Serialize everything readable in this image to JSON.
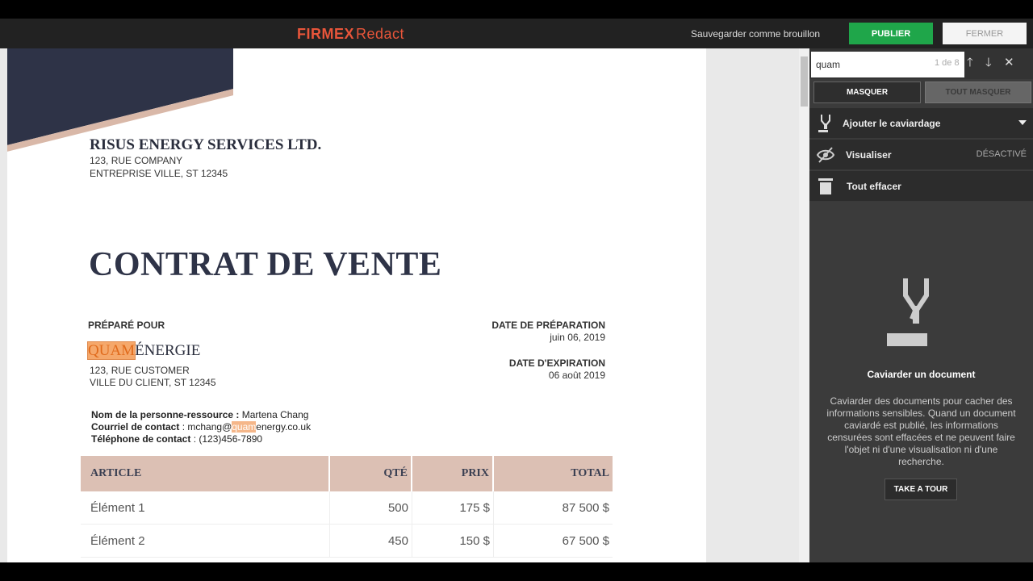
{
  "header": {
    "logo_firmex": "FIRMEX",
    "logo_redact": "Redact",
    "save_draft": "Sauvegarder comme brouillon",
    "publish": "PUBLIER",
    "close": "FERMER"
  },
  "document": {
    "company": {
      "name": "RISUS ENERGY SERVICES LTD.",
      "address_line1": "123, RUE COMPANY",
      "address_line2": "ENTREPRISE VILLE, ST 12345"
    },
    "title": "CONTRAT DE VENTE",
    "prepared_for_label": "PRÉPARÉ POUR",
    "prep_date_label": "DATE DE PRÉPARATION",
    "prep_date": "juin 06, 2019",
    "exp_date_label": "DATE D'EXPIRATION",
    "exp_date": "06 août 2019",
    "client": {
      "highlight": "QUAM",
      "name_rest": "ÉNERGIE",
      "address_line1": "123, RUE CUSTOMER",
      "address_line2": "VILLE DU CLIENT, ST 12345"
    },
    "contact": {
      "person_label": "Nom de la personne-ressource :",
      "person": "Martena Chang",
      "email_label": "Courriel de contact",
      "email_pre": ": mchang@",
      "email_hl": "quam",
      "email_post": "energy.co.uk",
      "phone_label": "Téléphone de contact",
      "phone": ": (123)456-7890"
    },
    "table": {
      "headers": [
        "ARTICLE",
        "QTÉ",
        "PRIX",
        "TOTAL"
      ],
      "rows": [
        [
          "Élément 1",
          "500",
          "175 $",
          "87 500 $"
        ],
        [
          "Élément 2",
          "450",
          "150 $",
          "67 500 $"
        ]
      ]
    }
  },
  "panel": {
    "search_value": "quam",
    "search_count": "1 de 8",
    "mask": "MASQUER",
    "mask_all": "TOUT MASQUER",
    "add_redaction": "Ajouter le caviardage",
    "visualize": "Visualiser",
    "visualize_status": "DÉSACTIVÉ",
    "clear_all": "Tout effacer",
    "empty_title": "Caviarder un document",
    "empty_desc": "Caviarder des documents pour cacher des informations sensibles. Quand un document caviardé est publié, les informations censurées sont effacées et ne peuvent faire l'objet ni d'une visualisation ni d'une recherche.",
    "tour": "TAKE A TOUR"
  },
  "colors": {
    "accent_brand": "#e8553a",
    "publish_green": "#1fa64a",
    "highlight": "#f5a86b",
    "table_header": "#dcc0b4"
  }
}
